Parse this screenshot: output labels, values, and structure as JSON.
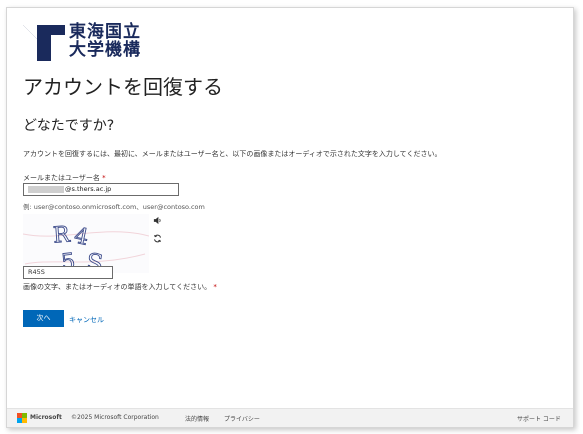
{
  "org": {
    "name_line1": "東海国立",
    "name_line2": "大学機構",
    "logo_color": "#1a2a5c"
  },
  "page": {
    "title": "アカウントを回復する",
    "subtitle": "どなたですか?",
    "instructions": "アカウントを回復するには、最初に、メールまたはユーザー名と、以下の画像またはオーディオで示された文字を入力してください。"
  },
  "form": {
    "email_label": "メールまたはユーザー名",
    "required_mark": "*",
    "email_value": "@s.thers.ac.jp",
    "example": "例: user@contoso.onmicrosoft.com、user@contoso.com",
    "captcha_image_text": "R45S",
    "captcha_value": "R45S",
    "captcha_hint": "画像の文字、またはオーディオの単語を入力してください。",
    "audio_icon": "speaker-icon",
    "refresh_icon": "refresh-icon"
  },
  "actions": {
    "next_label": "次へ",
    "cancel_label": "キャンセル",
    "primary_color": "#0067b8"
  },
  "footer": {
    "brand": "Microsoft",
    "copyright": "©2025 Microsoft Corporation",
    "legal": "法的情報",
    "privacy": "プライバシー",
    "support": "サポート コード"
  }
}
